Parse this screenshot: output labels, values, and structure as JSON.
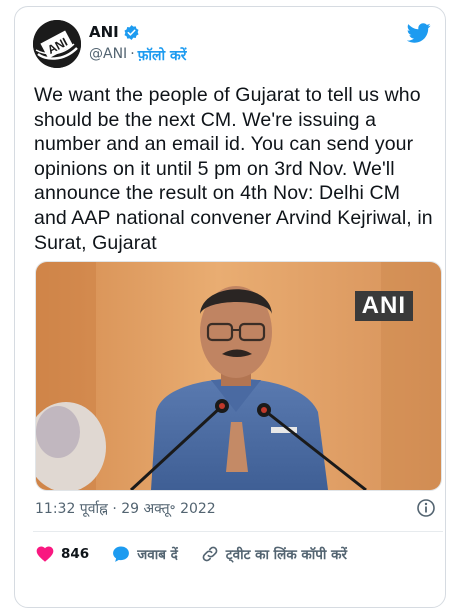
{
  "tweet": {
    "author_name": "ANI",
    "handle": "@ANI",
    "separator": "·",
    "follow_label": "फ़ॉलो करें",
    "text": "We want the people of Gujarat to tell us who should be the next CM. We're issuing a number and an email id. You can send your opinions on it until 5 pm on 3rd Nov. We'll announce the result on 4th Nov: Delhi CM and AAP national convener Arvind Kejriwal, in Surat, Gujarat",
    "media_watermark": "ANI",
    "timestamp": "11:32 पूर्वाह्न · 29 अक्तू॰ 2022",
    "like_count": "846",
    "reply_label": "जवाब दें",
    "copy_link_label": "ट्वीट का लिंक कॉपी करें",
    "avatar_text": "ANI"
  },
  "colors": {
    "accent": "#1d9bf0",
    "like": "#f91880",
    "text": "#0f1419",
    "secondary": "#536471"
  },
  "icons": [
    "verified-badge-icon",
    "twitter-bird-icon",
    "info-icon",
    "heart-icon",
    "reply-icon",
    "link-icon"
  ]
}
